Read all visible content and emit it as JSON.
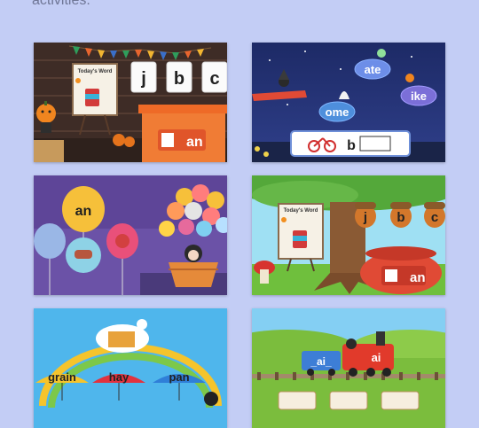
{
  "intro_text": "activities.",
  "cards": [
    {
      "id": "ws-bin",
      "sign_title": "Today's Word",
      "tiles": [
        "j",
        "b",
        "c"
      ],
      "answer_suffix": "an",
      "palette": {
        "wood": "#5b4134",
        "bin": "#f07c35"
      }
    },
    {
      "id": "ws-night",
      "bubbles": [
        "ate",
        "ike",
        "ome"
      ],
      "answer_prefix": "b",
      "palette": {
        "sky": "#2b3f86",
        "bubble": "#6d8ee8"
      }
    },
    {
      "id": "ws-balloons",
      "balloons": [
        "an"
      ],
      "palette": {
        "sky": "#6b52a7",
        "balloon": "#f6c03a"
      }
    },
    {
      "id": "ws-tree",
      "sign_title": "Today's Word",
      "acorns": [
        "j",
        "b",
        "c"
      ],
      "answer_suffix": "an",
      "palette": {
        "sky": "#9fe0f3",
        "grass": "#6fbf3d"
      }
    },
    {
      "id": "ws-umbrellas",
      "umbrellas": [
        "grain",
        "hay",
        "pan"
      ],
      "palette": {
        "sky": "#4fb6ec",
        "yellow": "#f5c42c",
        "red": "#e2323f",
        "blue": "#2f7fd8"
      }
    },
    {
      "id": "ws-train",
      "car_label": "_ai_",
      "engine_label": "ai",
      "palette": {
        "sky": "#84cff3",
        "grass": "#7bbd3d",
        "engine": "#e13a2b",
        "car": "#3d7ed6"
      }
    }
  ]
}
